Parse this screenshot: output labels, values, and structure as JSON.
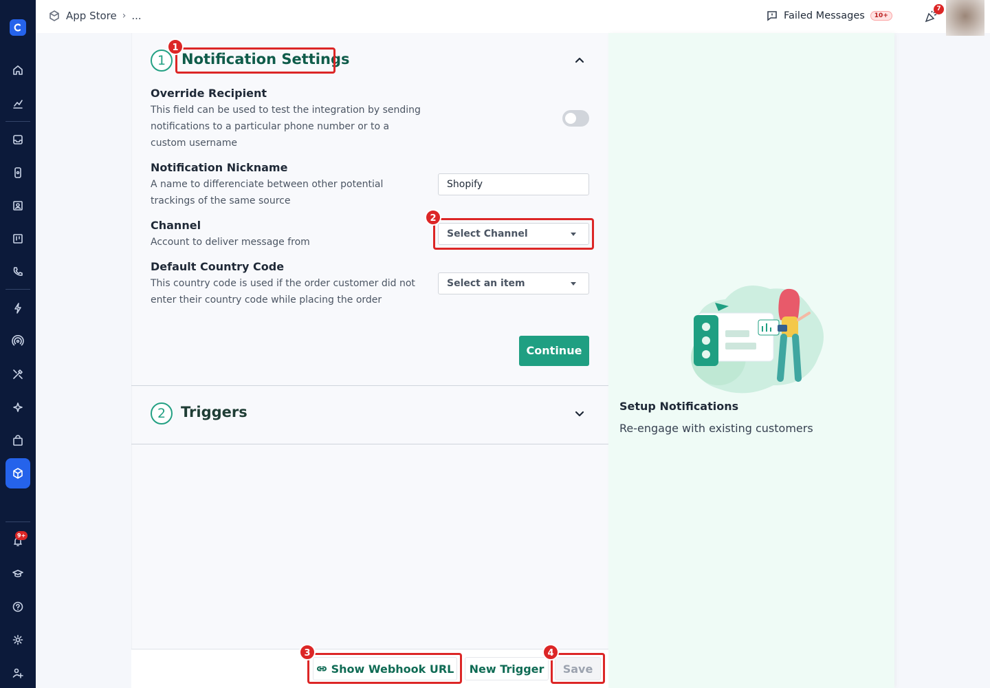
{
  "breadcrumb": {
    "app_store": "App Store",
    "ellipsis": "..."
  },
  "header": {
    "failed_messages": "Failed Messages",
    "failed_count": "10+",
    "notifications_count": "7"
  },
  "sidebar": {
    "notification_badge": "9+"
  },
  "section1": {
    "number": "1",
    "title": "Notification Settings",
    "override_label": "Override Recipient",
    "override_desc": "This field can be used to test the integration by sending notifications to a particular phone number or to a custom username",
    "override_enabled": false,
    "nickname_label": "Notification Nickname",
    "nickname_desc": "A name to differenciate between other potential trackings of the same source",
    "nickname_value": "Shopify",
    "channel_label": "Channel",
    "channel_desc": "Account to deliver message from",
    "channel_value": "Select Channel",
    "country_label": "Default Country Code",
    "country_desc": "This country code is used if the order customer did not enter their country code while placing the order",
    "country_value": "Select an item",
    "continue_label": "Continue"
  },
  "section2": {
    "number": "2",
    "title": "Triggers"
  },
  "footer": {
    "webhook_label": "Show Webhook URL",
    "new_trigger_label": "New Trigger",
    "save_label": "Save"
  },
  "markers": {
    "m1": "1",
    "m2": "2",
    "m3": "3",
    "m4": "4"
  },
  "side_panel": {
    "title": "Setup Notifications",
    "subtitle": "Re-engage with existing customers"
  },
  "colors": {
    "accent": "#1f9f82",
    "highlight": "#dc2626",
    "sidebar": "#0c1a3a",
    "active": "#2563eb"
  }
}
